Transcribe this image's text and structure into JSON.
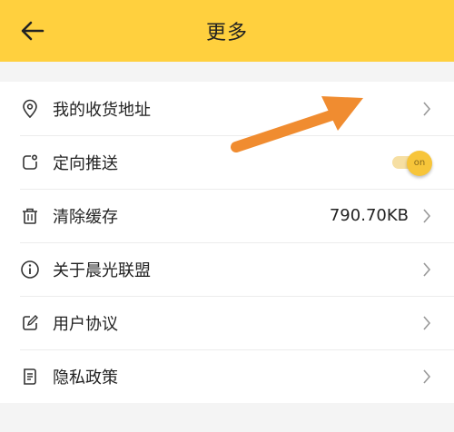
{
  "header": {
    "title": "更多",
    "back_icon": "arrow-left-icon",
    "background": "#ffd03e"
  },
  "menu": {
    "items": [
      {
        "label": "我的收货地址",
        "icon": "location-pin-icon",
        "value": ""
      },
      {
        "label": "定向推送",
        "icon": "push-notification-icon",
        "toggle": "on",
        "toggle_state": true
      },
      {
        "label": "清除缓存",
        "icon": "trash-icon",
        "value": "790.70KB"
      },
      {
        "label": "关于晨光联盟",
        "icon": "info-icon",
        "value": ""
      },
      {
        "label": "用户协议",
        "icon": "edit-document-icon",
        "value": ""
      },
      {
        "label": "隐私政策",
        "icon": "document-list-icon",
        "value": ""
      }
    ]
  },
  "annotation": {
    "color": "#f08c30",
    "icon": "orange-arrow-pointer"
  }
}
